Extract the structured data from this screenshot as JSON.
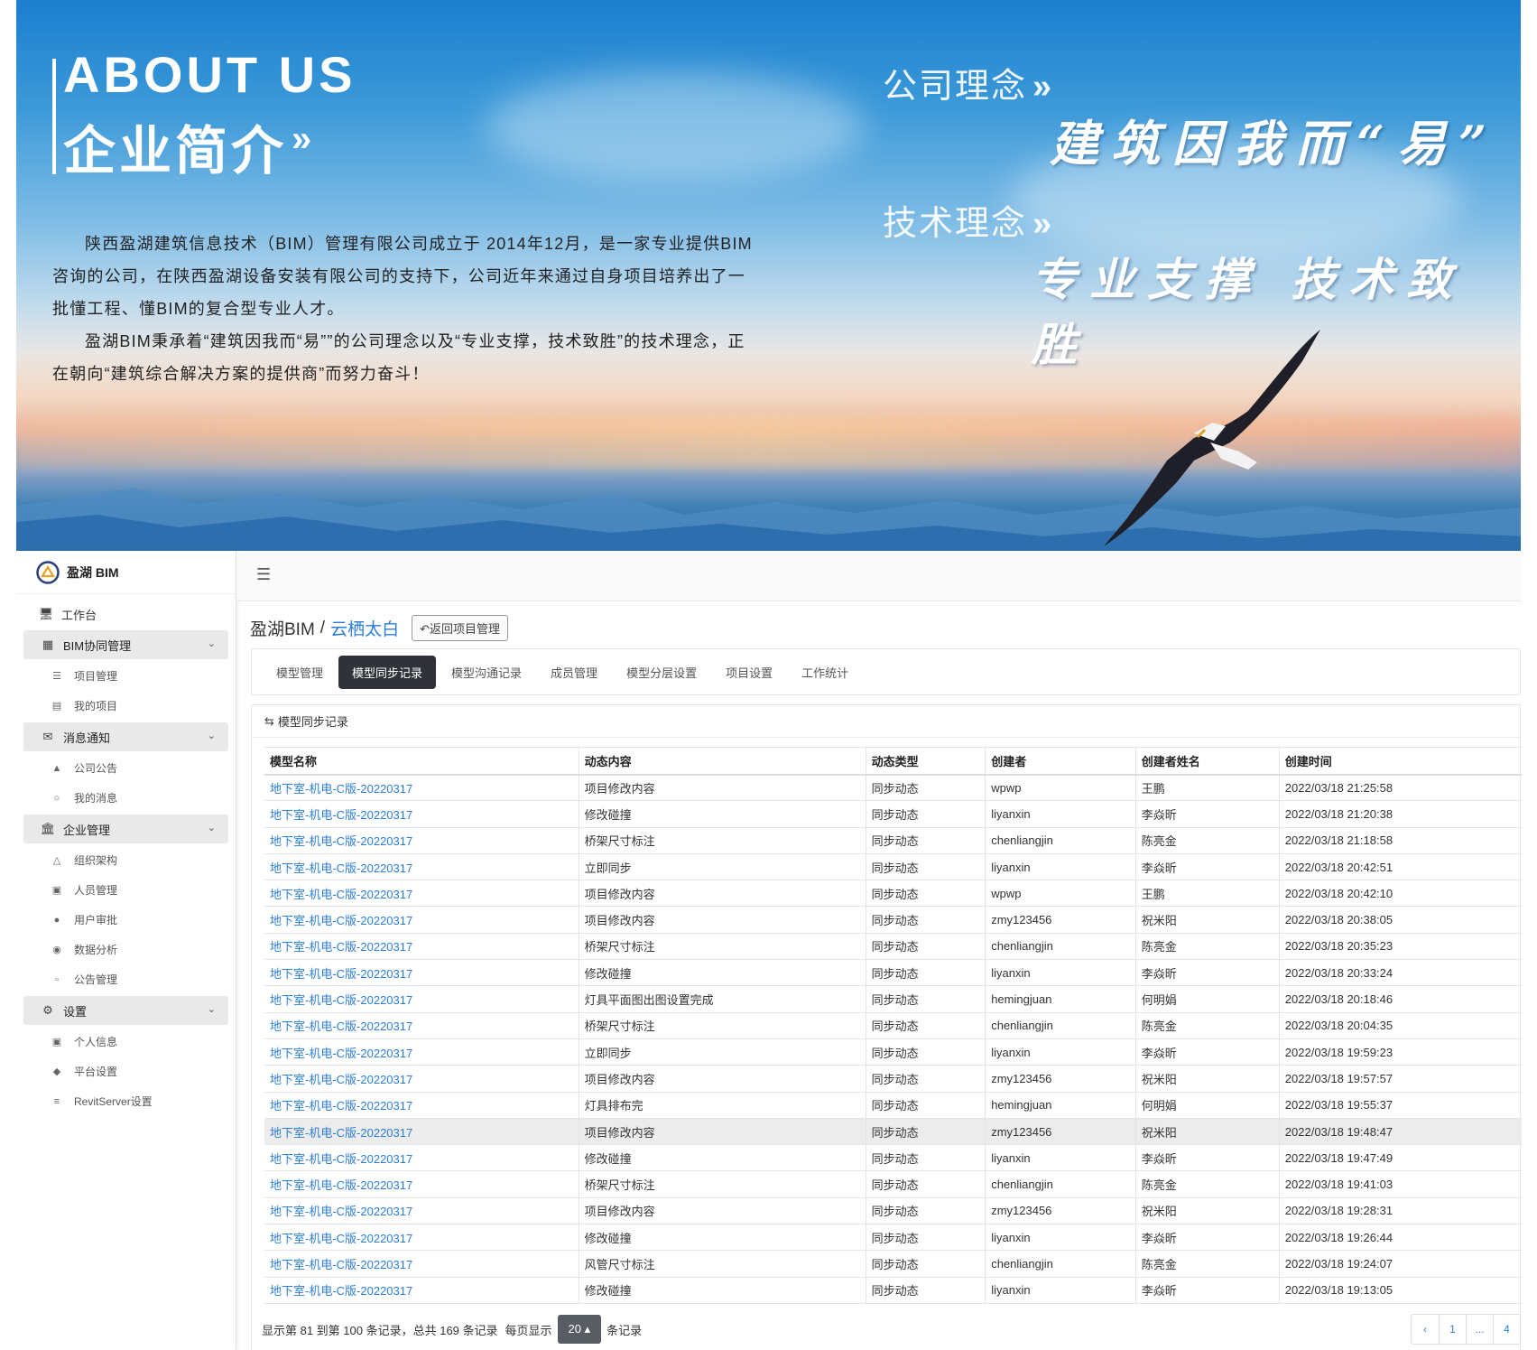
{
  "banner": {
    "about_en": "ABOUT US",
    "about_cn": "企业简介",
    "about_arrows": "»",
    "intro_p1": "陕西盈湖建筑信息技术（BIM）管理有限公司成立于 2014年12月，是一家专业提供BIM咨询的公司，在陕西盈湖设备安装有限公司的支持下，公司近年来通过自身项目培养出了一批懂工程、懂BIM的复合型专业人才。",
    "intro_p2": "盈湖BIM秉承着“建筑因我而“易””的公司理念以及“专业支撑，技术致胜”的技术理念，正在朝向“建筑综合解决方案的提供商”而努力奋斗！",
    "concept1_label": "公司理念",
    "concept1_slogan": "建筑因我而“易”",
    "concept2_label": "技术理念",
    "concept2_slogan": "专业支撑 技术致胜",
    "chev": "»"
  },
  "sidebar": {
    "brand": "盈湖 BIM",
    "top_item": {
      "label": "工作台",
      "icon": "monitor-icon"
    },
    "groups": [
      {
        "label": "BIM协同管理",
        "icon": "network-icon",
        "items": [
          {
            "label": "项目管理",
            "icon": "list-icon"
          },
          {
            "label": "我的项目",
            "icon": "list-alt-icon"
          }
        ]
      },
      {
        "label": "消息通知",
        "icon": "envelope-icon",
        "items": [
          {
            "label": "公司公告",
            "icon": "bullhorn-icon"
          },
          {
            "label": "我的消息",
            "icon": "comments-icon"
          }
        ]
      },
      {
        "label": "企业管理",
        "icon": "bank-icon",
        "items": [
          {
            "label": "组织架构",
            "icon": "sitemap-icon"
          },
          {
            "label": "人员管理",
            "icon": "id-card-icon"
          },
          {
            "label": "用户审批",
            "icon": "user-plus-icon"
          },
          {
            "label": "数据分析",
            "icon": "dashboard-icon"
          },
          {
            "label": "公告管理",
            "icon": "calendar-icon"
          }
        ]
      },
      {
        "label": "设置",
        "icon": "gear-icon",
        "items": [
          {
            "label": "个人信息",
            "icon": "vcard-icon"
          },
          {
            "label": "平台设置",
            "icon": "tags-icon"
          },
          {
            "label": "RevitServer设置",
            "icon": "server-icon"
          }
        ]
      }
    ]
  },
  "header": {
    "crumb_root": "盈湖BIM",
    "crumb_sep": "/",
    "crumb_project": "云栖太白",
    "back_label": "返回项目管理"
  },
  "tabs": [
    "模型管理",
    "模型同步记录",
    "模型沟通记录",
    "成员管理",
    "模型分层设置",
    "项目设置",
    "工作统计"
  ],
  "active_tab": 1,
  "panel_title": "模型同步记录",
  "table": {
    "columns": [
      "模型名称",
      "动态内容",
      "动态类型",
      "创建者",
      "创建者姓名",
      "创建时间"
    ],
    "rows": [
      [
        "地下室-机电-C版-20220317",
        "项目修改内容",
        "同步动态",
        "wpwp",
        "王鹏",
        "2022/03/18 21:25:58"
      ],
      [
        "地下室-机电-C版-20220317",
        "修改碰撞",
        "同步动态",
        "liyanxin",
        "李焱昕",
        "2022/03/18 21:20:38"
      ],
      [
        "地下室-机电-C版-20220317",
        "桥架尺寸标注",
        "同步动态",
        "chenliangjin",
        "陈亮金",
        "2022/03/18 21:18:58"
      ],
      [
        "地下室-机电-C版-20220317",
        "立即同步",
        "同步动态",
        "liyanxin",
        "李焱昕",
        "2022/03/18 20:42:51"
      ],
      [
        "地下室-机电-C版-20220317",
        "项目修改内容",
        "同步动态",
        "wpwp",
        "王鹏",
        "2022/03/18 20:42:10"
      ],
      [
        "地下室-机电-C版-20220317",
        "项目修改内容",
        "同步动态",
        "zmy123456",
        "祝米阳",
        "2022/03/18 20:38:05"
      ],
      [
        "地下室-机电-C版-20220317",
        "桥架尺寸标注",
        "同步动态",
        "chenliangjin",
        "陈亮金",
        "2022/03/18 20:35:23"
      ],
      [
        "地下室-机电-C版-20220317",
        "修改碰撞",
        "同步动态",
        "liyanxin",
        "李焱昕",
        "2022/03/18 20:33:24"
      ],
      [
        "地下室-机电-C版-20220317",
        "灯具平面图出图设置完成",
        "同步动态",
        "hemingjuan",
        "何明娟",
        "2022/03/18 20:18:46"
      ],
      [
        "地下室-机电-C版-20220317",
        "桥架尺寸标注",
        "同步动态",
        "chenliangjin",
        "陈亮金",
        "2022/03/18 20:04:35"
      ],
      [
        "地下室-机电-C版-20220317",
        "立即同步",
        "同步动态",
        "liyanxin",
        "李焱昕",
        "2022/03/18 19:59:23"
      ],
      [
        "地下室-机电-C版-20220317",
        "项目修改内容",
        "同步动态",
        "zmy123456",
        "祝米阳",
        "2022/03/18 19:57:57"
      ],
      [
        "地下室-机电-C版-20220317",
        "灯具排布完",
        "同步动态",
        "hemingjuan",
        "何明娟",
        "2022/03/18 19:55:37"
      ],
      [
        "地下室-机电-C版-20220317",
        "项目修改内容",
        "同步动态",
        "zmy123456",
        "祝米阳",
        "2022/03/18 19:48:47"
      ],
      [
        "地下室-机电-C版-20220317",
        "修改碰撞",
        "同步动态",
        "liyanxin",
        "李焱昕",
        "2022/03/18 19:47:49"
      ],
      [
        "地下室-机电-C版-20220317",
        "桥架尺寸标注",
        "同步动态",
        "chenliangjin",
        "陈亮金",
        "2022/03/18 19:41:03"
      ],
      [
        "地下室-机电-C版-20220317",
        "项目修改内容",
        "同步动态",
        "zmy123456",
        "祝米阳",
        "2022/03/18 19:28:31"
      ],
      [
        "地下室-机电-C版-20220317",
        "修改碰撞",
        "同步动态",
        "liyanxin",
        "李焱昕",
        "2022/03/18 19:26:44"
      ],
      [
        "地下室-机电-C版-20220317",
        "风管尺寸标注",
        "同步动态",
        "chenliangjin",
        "陈亮金",
        "2022/03/18 19:24:07"
      ],
      [
        "地下室-机电-C版-20220317",
        "修改碰撞",
        "同步动态",
        "liyanxin",
        "李焱昕",
        "2022/03/18 19:13:05"
      ]
    ],
    "highlighted_row": 13
  },
  "footer": {
    "summary": "显示第 81 到第 100 条记录，总共 169 条记录",
    "per_page_prefix": "每页显示",
    "per_page_value": "20",
    "per_page_suffix": "条记录"
  },
  "pager": [
    "‹",
    "1",
    "...",
    "4"
  ],
  "colors": {
    "accent_link": "#2b7dd8",
    "active_tab": "#2f3238"
  }
}
